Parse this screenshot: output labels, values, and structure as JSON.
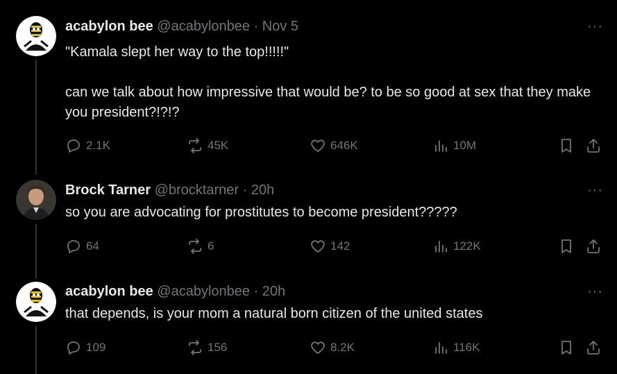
{
  "tweets": [
    {
      "name": "acabylon bee",
      "handle": "@acabylonbee",
      "time": "Nov 5",
      "text": "\"Kamala slept her way to the top!!!!!\"\n\ncan we talk about how impressive that would be? to be so good at sex that they make you president?!?!?",
      "replies": "2.1K",
      "reposts": "45K",
      "likes": "646K",
      "views": "10M",
      "avatar_icon": "bee-mask-avatar-icon"
    },
    {
      "name": "Brock Tarner",
      "handle": "@brocktarner",
      "time": "20h",
      "text": "so you are advocating for prostitutes to become president?????",
      "replies": "64",
      "reposts": "6",
      "likes": "142",
      "views": "122K",
      "avatar_icon": "person-photo-avatar-icon"
    },
    {
      "name": "acabylon bee",
      "handle": "@acabylonbee",
      "time": "20h",
      "text": "that depends, is your mom a natural born citizen of the united states",
      "replies": "109",
      "reposts": "156",
      "likes": "8.2K",
      "views": "116K",
      "avatar_icon": "bee-mask-avatar-icon"
    }
  ],
  "separator": " · ",
  "more_glyph": "···",
  "colors": {
    "background": "#000000",
    "text": "#e7e9ea",
    "muted": "#71767b",
    "thread_line": "#333639"
  }
}
